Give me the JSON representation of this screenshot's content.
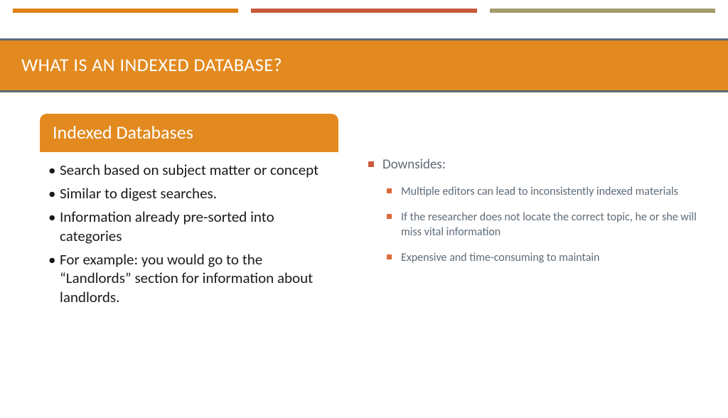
{
  "title": "WHAT IS AN INDEXED DATABASE?",
  "left": {
    "header": "Indexed Databases",
    "items": [
      "Search based on subject matter or concept",
      "Similar to digest searches.",
      "Information already pre-sorted into categories",
      "For example: you would go to the “Landlords” section for information about landlords."
    ]
  },
  "right": {
    "lead": "Downsides:",
    "items": [
      "Multiple editors can lead to inconsistently indexed materials",
      "If the researcher does not locate the correct topic, he or she will miss vital information",
      "Expensive and time-consuming to maintain"
    ]
  }
}
